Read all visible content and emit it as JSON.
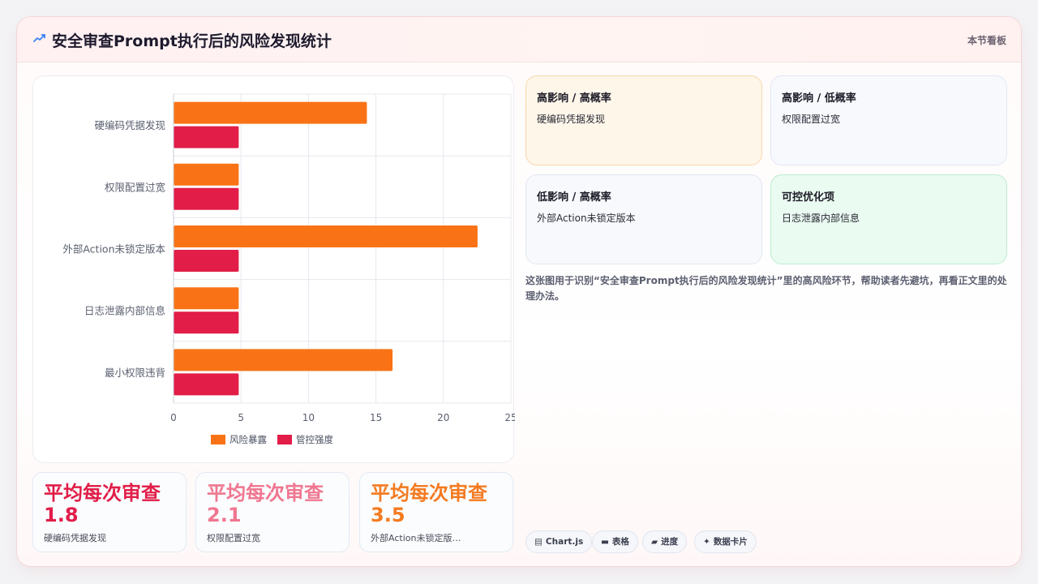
{
  "header": {
    "icon": "trend-line-icon",
    "title": "安全审查Prompt执行后的风险发现统计",
    "right_label": "本节看板"
  },
  "chart_data": {
    "type": "bar",
    "orientation": "horizontal",
    "categories": [
      "硬编码凭据发现",
      "权限配置过宽",
      "外部Action未锁定版本",
      "日志泄露内部信息",
      "最小权限违背"
    ],
    "series": [
      {
        "name": "风险暴露",
        "color": "#f97316",
        "values": [
          14.3,
          4.8,
          22.5,
          4.8,
          16.2
        ]
      },
      {
        "name": "管控强度",
        "color": "#e11d48",
        "values": [
          4.8,
          4.8,
          4.8,
          4.8,
          4.8
        ]
      }
    ],
    "xlim": [
      0,
      25
    ],
    "xticks": [
      "0",
      "5",
      "10",
      "15",
      "20",
      "25"
    ],
    "grid": true,
    "legend_position": "bottom"
  },
  "stats": [
    {
      "value": "平均每次审查1.8",
      "label": "硬编码凭据发现",
      "color": "#e11d48"
    },
    {
      "value": "平均每次审查2.1",
      "label": "权限配置过宽",
      "color": "#f07690"
    },
    {
      "value": "平均每次审查3.5",
      "label": "外部Action未锁定版…",
      "color": "#f47a1f"
    }
  ],
  "quadrants": [
    {
      "title": "高影响 / 高概率",
      "body": "硬编码凭据发现",
      "bg": "#fff6ea",
      "border": "#f6d7a9"
    },
    {
      "title": "高影响 / 低概率",
      "body": "权限配置过宽",
      "bg": "#f7f9fd",
      "border": "#e2e7f1"
    },
    {
      "title": "低影响 / 高概率",
      "body": "外部Action未锁定版本",
      "bg": "#f7f9fd",
      "border": "#e2e7f1"
    },
    {
      "title": "可控优化项",
      "body": "日志泄露内部信息",
      "bg": "#eafbf1",
      "border": "#bfeccf"
    }
  ],
  "note": "这张图用于识别“安全审查Prompt执行后的风险发现统计”里的高风险环节，帮助读者先避坑，再看正文里的处理办法。",
  "chips": [
    {
      "icon": "chart-icon",
      "glyph": "▤",
      "label": "Chart.js"
    },
    {
      "icon": "table-icon",
      "glyph": "▬",
      "label": "表格"
    },
    {
      "icon": "progress-icon",
      "glyph": "▰",
      "label": "进度"
    },
    {
      "icon": "sparkle-icon",
      "glyph": "✦",
      "label": "数据卡片"
    }
  ]
}
